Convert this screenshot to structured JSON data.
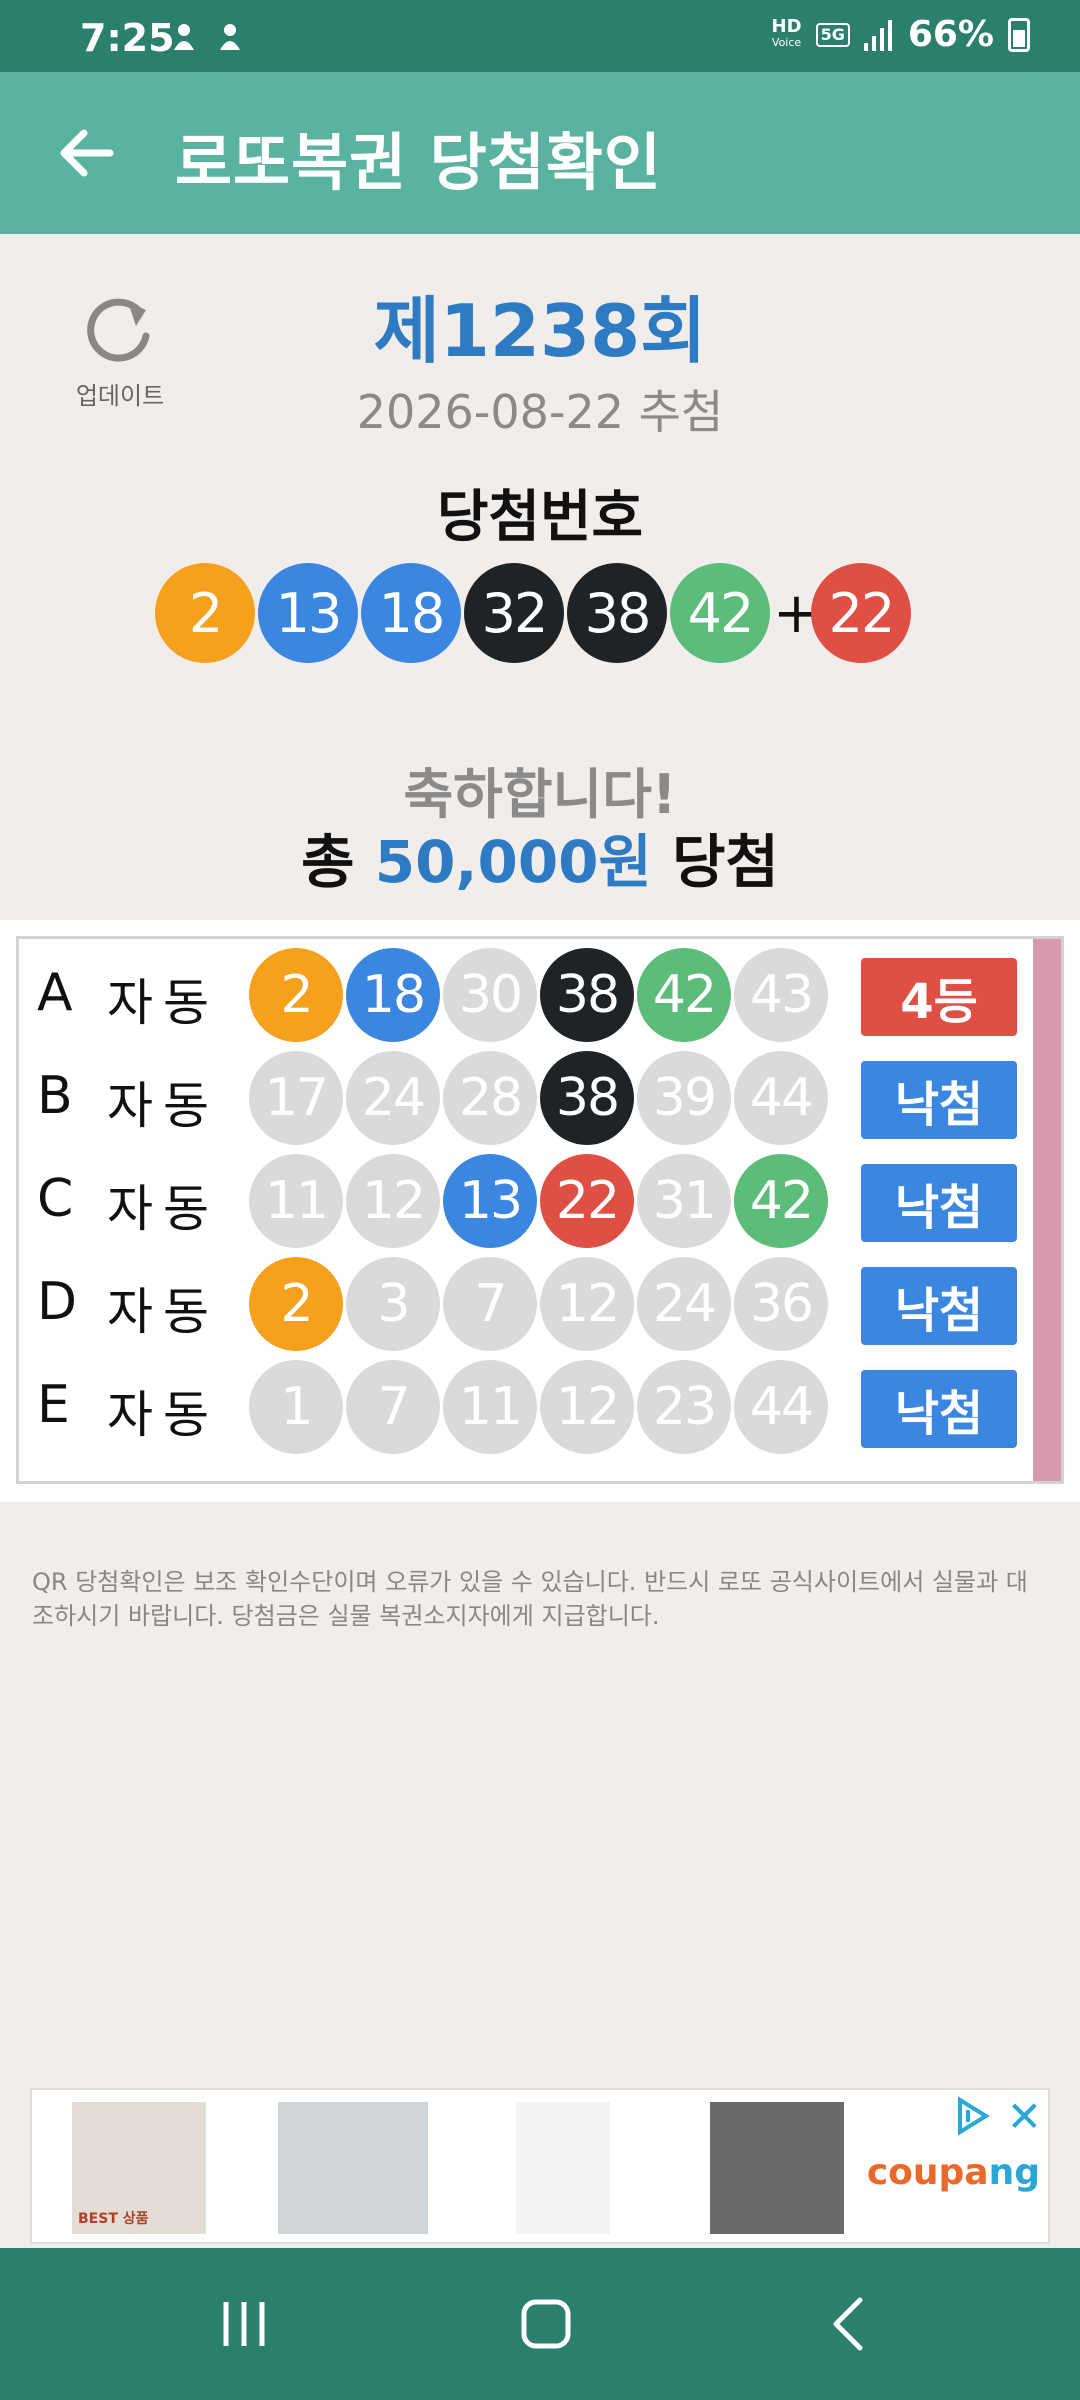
{
  "status": {
    "time": "7:25",
    "hd_voice": "HD",
    "hd_voice_sub": "Voice",
    "network": "5G",
    "battery": "66%"
  },
  "app_bar": {
    "title": "로또복권 당첨확인"
  },
  "refresh_label": "업데이트",
  "draw": {
    "number": "제1238회",
    "date": "2026-08-22 추첨"
  },
  "winning": {
    "title": "당첨번호",
    "numbers": [
      "2",
      "13",
      "18",
      "32",
      "38",
      "42"
    ],
    "plus": "+",
    "bonus": "22"
  },
  "result": {
    "congrats": "축하합니다!",
    "total_prefix": "총 ",
    "total_amount": "50,000원",
    "total_suffix": " 당첨"
  },
  "games": [
    {
      "letter": "A",
      "mode": "자동",
      "numbers": [
        "2",
        "18",
        "30",
        "38",
        "42",
        "43"
      ],
      "result": "4등"
    },
    {
      "letter": "B",
      "mode": "자동",
      "numbers": [
        "17",
        "24",
        "28",
        "38",
        "39",
        "44"
      ],
      "result": "낙첨"
    },
    {
      "letter": "C",
      "mode": "자동",
      "numbers": [
        "11",
        "12",
        "13",
        "22",
        "31",
        "42"
      ],
      "result": "낙첨"
    },
    {
      "letter": "D",
      "mode": "자동",
      "numbers": [
        "2",
        "3",
        "7",
        "12",
        "24",
        "36"
      ],
      "result": "낙첨"
    },
    {
      "letter": "E",
      "mode": "자동",
      "numbers": [
        "1",
        "7",
        "11",
        "12",
        "23",
        "44"
      ],
      "result": "낙첨"
    }
  ],
  "notice": "QR 당첨확인은 보조 확인수단이며 오류가 있을 수 있습니다. 반드시 로또 공식사이트에서 실물과 대조하시기 바랍니다. 당첨금은 실물 복권소지자에게 지급합니다.",
  "ad": {
    "brand_part1": "coupa",
    "brand_part2": "ng",
    "close": "✕",
    "img1_text": "BEST 상품"
  },
  "colors": {
    "status_bar": "#2a7f6d",
    "app_bar": "#5ab3a0",
    "ball_yellow": "#f5a11e",
    "ball_blue": "#3a86e0",
    "ball_black": "#1f2326",
    "ball_green": "#5cbd7b",
    "ball_red": "#e04f43",
    "ball_gray": "#dadada",
    "badge_win": "#e04f43",
    "badge_lose": "#3a86e0"
  }
}
